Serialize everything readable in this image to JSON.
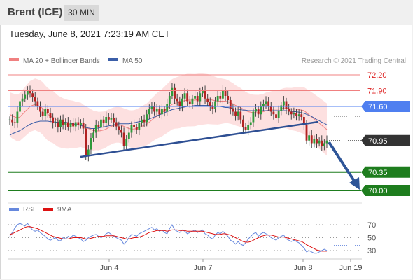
{
  "header": {
    "instrument": "Brent (ICE)",
    "timeframe": "30 MIN",
    "datetime": "Tuesday, June 8, 2021 7:23:19 AM CET"
  },
  "legend": {
    "ma20_bollinger": "MA 20 + Bollinger Bands",
    "ma50": "MA 50",
    "credit": "Research © 2021 Trading Central",
    "rsi": "RSI",
    "rsi_ma": "9MA"
  },
  "colors": {
    "bollinger_band": "#fde0e0",
    "ma20": "#f08080",
    "ma50": "#3b5ea8",
    "resistance": "#f08080",
    "pivot": "#4f7ff0",
    "support": "#1e7d1e",
    "current": "#333333",
    "trendline": "#2e4f93",
    "arrow": "#2e5598",
    "rsi": "#6688dd",
    "rsi_ma": "#dd1111"
  },
  "chart_data": [
    {
      "type": "candlestick",
      "title": "Brent (ICE)",
      "timeframe": "30 MIN",
      "x_ticks": [
        "Jun 4",
        "Jun 7",
        "Jun 8",
        "Jun 19"
      ],
      "ylim": [
        69.85,
        72.35
      ],
      "levels": [
        {
          "value": 72.2,
          "label": "72.20",
          "kind": "resistance"
        },
        {
          "value": 71.9,
          "label": "71.90",
          "kind": "resistance"
        },
        {
          "value": 71.6,
          "label": "71.60",
          "kind": "pivot"
        },
        {
          "value": 70.95,
          "label": "70.95",
          "kind": "current"
        },
        {
          "value": 70.35,
          "label": "70.35",
          "kind": "support"
        },
        {
          "value": 70.0,
          "label": "70.00",
          "kind": "support"
        }
      ],
      "closes": [
        71.35,
        71.3,
        71.28,
        71.5,
        71.7,
        71.75,
        71.82,
        71.9,
        71.85,
        71.78,
        71.7,
        71.6,
        71.5,
        71.42,
        71.55,
        71.48,
        71.38,
        71.28,
        71.3,
        71.2,
        71.35,
        71.25,
        71.3,
        71.2,
        71.28,
        71.22,
        71.3,
        71.25,
        71.28,
        71.18,
        70.65,
        70.78,
        71.0,
        71.1,
        71.25,
        71.2,
        71.35,
        71.28,
        71.4,
        71.35,
        71.38,
        71.3,
        71.22,
        71.15,
        71.1,
        70.85,
        70.98,
        71.1,
        71.25,
        71.2,
        71.15,
        71.28,
        71.35,
        71.3,
        71.45,
        71.55,
        71.6,
        71.5,
        71.55,
        71.45,
        71.55,
        71.5,
        71.65,
        71.8,
        71.95,
        71.75,
        71.7,
        71.6,
        71.75,
        71.85,
        71.7,
        71.65,
        71.75,
        71.8,
        71.7,
        71.85,
        71.9,
        71.75,
        71.68,
        71.6,
        71.55,
        71.7,
        71.8,
        71.75,
        71.9,
        71.8,
        71.72,
        71.55,
        71.5,
        71.42,
        71.5,
        71.35,
        71.2,
        71.15,
        71.25,
        71.3,
        71.5,
        71.55,
        71.45,
        71.6,
        71.65,
        71.7,
        71.6,
        71.5,
        71.45,
        71.38,
        71.52,
        71.62,
        71.7,
        71.55,
        71.5,
        71.45,
        71.48,
        71.42,
        71.45,
        71.4,
        71.25,
        70.95,
        71.05,
        70.9,
        70.98,
        70.9,
        70.95,
        70.85,
        70.9,
        70.95
      ],
      "ma20": [
        71.45,
        71.42,
        71.4,
        71.38,
        71.4,
        71.45,
        71.5,
        71.55,
        71.6,
        71.62,
        71.64,
        71.62,
        71.6,
        71.56,
        71.5,
        71.45,
        71.42,
        71.4,
        71.36,
        71.32,
        71.3,
        71.28,
        71.27,
        71.26,
        71.26,
        71.26,
        71.25,
        71.25,
        71.25,
        71.22,
        71.2,
        71.18,
        71.16,
        71.14,
        71.14,
        71.13,
        71.14,
        71.15,
        71.17,
        71.2,
        71.22,
        71.24,
        71.25,
        71.25,
        71.24,
        71.22,
        71.2,
        71.18,
        71.17,
        71.17,
        71.18,
        71.2,
        71.22,
        71.24,
        71.26,
        71.3,
        71.34,
        71.38,
        71.42,
        71.45,
        71.48,
        71.52,
        71.56,
        71.6,
        71.64,
        71.66,
        71.67,
        71.68,
        71.7,
        71.71,
        71.72,
        71.72,
        71.72,
        71.72,
        71.73,
        71.74,
        71.74,
        71.74,
        71.74,
        71.73,
        71.72,
        71.71,
        71.7,
        71.7,
        71.7,
        71.7,
        71.69,
        71.67,
        71.65,
        71.62,
        71.6,
        71.58,
        71.55,
        71.52,
        71.5,
        71.49,
        71.48,
        71.48,
        71.48,
        71.49,
        71.5,
        71.52,
        71.53,
        71.54,
        71.55,
        71.55,
        71.55,
        71.56,
        71.57,
        71.57,
        71.56,
        71.55,
        71.55,
        71.55,
        71.54,
        71.53,
        71.52,
        71.48,
        71.44,
        71.4,
        71.36,
        71.32,
        71.28,
        71.24,
        71.2,
        71.16
      ],
      "ma50": [
        71.05,
        71.08,
        71.1,
        71.12,
        71.14,
        71.17,
        71.2,
        71.23,
        71.26,
        71.28,
        71.3,
        71.31,
        71.32,
        71.32,
        71.32,
        71.32,
        71.31,
        71.31,
        71.3,
        71.3,
        71.3,
        71.3,
        71.3,
        71.29,
        71.28,
        71.27,
        71.26,
        71.25,
        71.24,
        71.22,
        71.2,
        71.19,
        71.18,
        71.18,
        71.18,
        71.19,
        71.2,
        71.21,
        71.22,
        71.23,
        71.24,
        71.25,
        71.26,
        71.27,
        71.27,
        71.27,
        71.27,
        71.27,
        71.28,
        71.29,
        71.3,
        71.31,
        71.32,
        71.33,
        71.34,
        71.36,
        71.38,
        71.4,
        71.42,
        71.44,
        71.46,
        71.48,
        71.5,
        71.52,
        71.54,
        71.55,
        71.56,
        71.57,
        71.58,
        71.59,
        71.6,
        71.6,
        71.61,
        71.62,
        71.62,
        71.62,
        71.62,
        71.62,
        71.62,
        71.62,
        71.61,
        71.6,
        71.6,
        71.6,
        71.59,
        71.58,
        71.58,
        71.57,
        71.56,
        71.55,
        71.55,
        71.54,
        71.53,
        71.53,
        71.52,
        71.52,
        71.52,
        71.52,
        71.52,
        71.52,
        71.52,
        71.52,
        71.52,
        71.52,
        71.52,
        71.52,
        71.52,
        71.52,
        71.52,
        71.52,
        71.51,
        71.51,
        71.5,
        71.5,
        71.49,
        71.48,
        71.47,
        71.45,
        71.43,
        71.41,
        71.38,
        71.35,
        71.33,
        71.3,
        71.28,
        71.25
      ]
    },
    {
      "type": "line",
      "title": "RSI",
      "yticks": [
        30,
        50,
        70
      ],
      "ylim": [
        20,
        80
      ],
      "series": [
        {
          "name": "RSI",
          "values": [
            52,
            58,
            65,
            70,
            72,
            70,
            68,
            72,
            66,
            62,
            60,
            62,
            58,
            55,
            52,
            48,
            46,
            48,
            50,
            46,
            45,
            50,
            48,
            52,
            50,
            54,
            52,
            50,
            48,
            44,
            46,
            50,
            52,
            54,
            55,
            52,
            50,
            52,
            56,
            58,
            55,
            52,
            50,
            48,
            46,
            40,
            44,
            50,
            55,
            54,
            52,
            56,
            58,
            60,
            62,
            64,
            66,
            62,
            64,
            60,
            62,
            58,
            56,
            64,
            70,
            62,
            60,
            58,
            62,
            60,
            56,
            58,
            60,
            62,
            58,
            60,
            62,
            56,
            54,
            50,
            48,
            54,
            58,
            56,
            60,
            56,
            52,
            46,
            44,
            40,
            44,
            40,
            38,
            42,
            48,
            52,
            56,
            58,
            52,
            56,
            58,
            56,
            54,
            50,
            48,
            46,
            50,
            52,
            54,
            48,
            46,
            44,
            46,
            44,
            42,
            38,
            34,
            28,
            30,
            28,
            26,
            26,
            28,
            30,
            32,
            30
          ]
        },
        {
          "name": "9MA",
          "values": [
            55,
            56,
            58,
            60,
            62,
            64,
            66,
            67,
            67,
            66,
            65,
            64,
            62,
            60,
            58,
            56,
            54,
            52,
            51,
            50,
            49,
            48,
            48,
            48,
            49,
            50,
            50,
            50,
            50,
            49,
            48,
            48,
            49,
            50,
            51,
            52,
            52,
            52,
            53,
            53,
            53,
            53,
            52,
            51,
            50,
            49,
            48,
            48,
            49,
            50,
            50,
            51,
            52,
            54,
            56,
            58,
            59,
            60,
            61,
            61,
            61,
            61,
            60,
            61,
            62,
            62,
            62,
            61,
            61,
            61,
            60,
            60,
            60,
            60,
            60,
            60,
            60,
            59,
            58,
            57,
            56,
            55,
            55,
            55,
            56,
            56,
            55,
            54,
            52,
            50,
            48,
            46,
            44,
            43,
            43,
            44,
            46,
            48,
            50,
            52,
            53,
            54,
            54,
            54,
            53,
            52,
            51,
            51,
            51,
            50,
            49,
            48,
            47,
            46,
            45,
            44,
            42,
            39,
            37,
            35,
            33,
            31,
            30,
            29,
            29,
            29
          ]
        }
      ]
    }
  ]
}
